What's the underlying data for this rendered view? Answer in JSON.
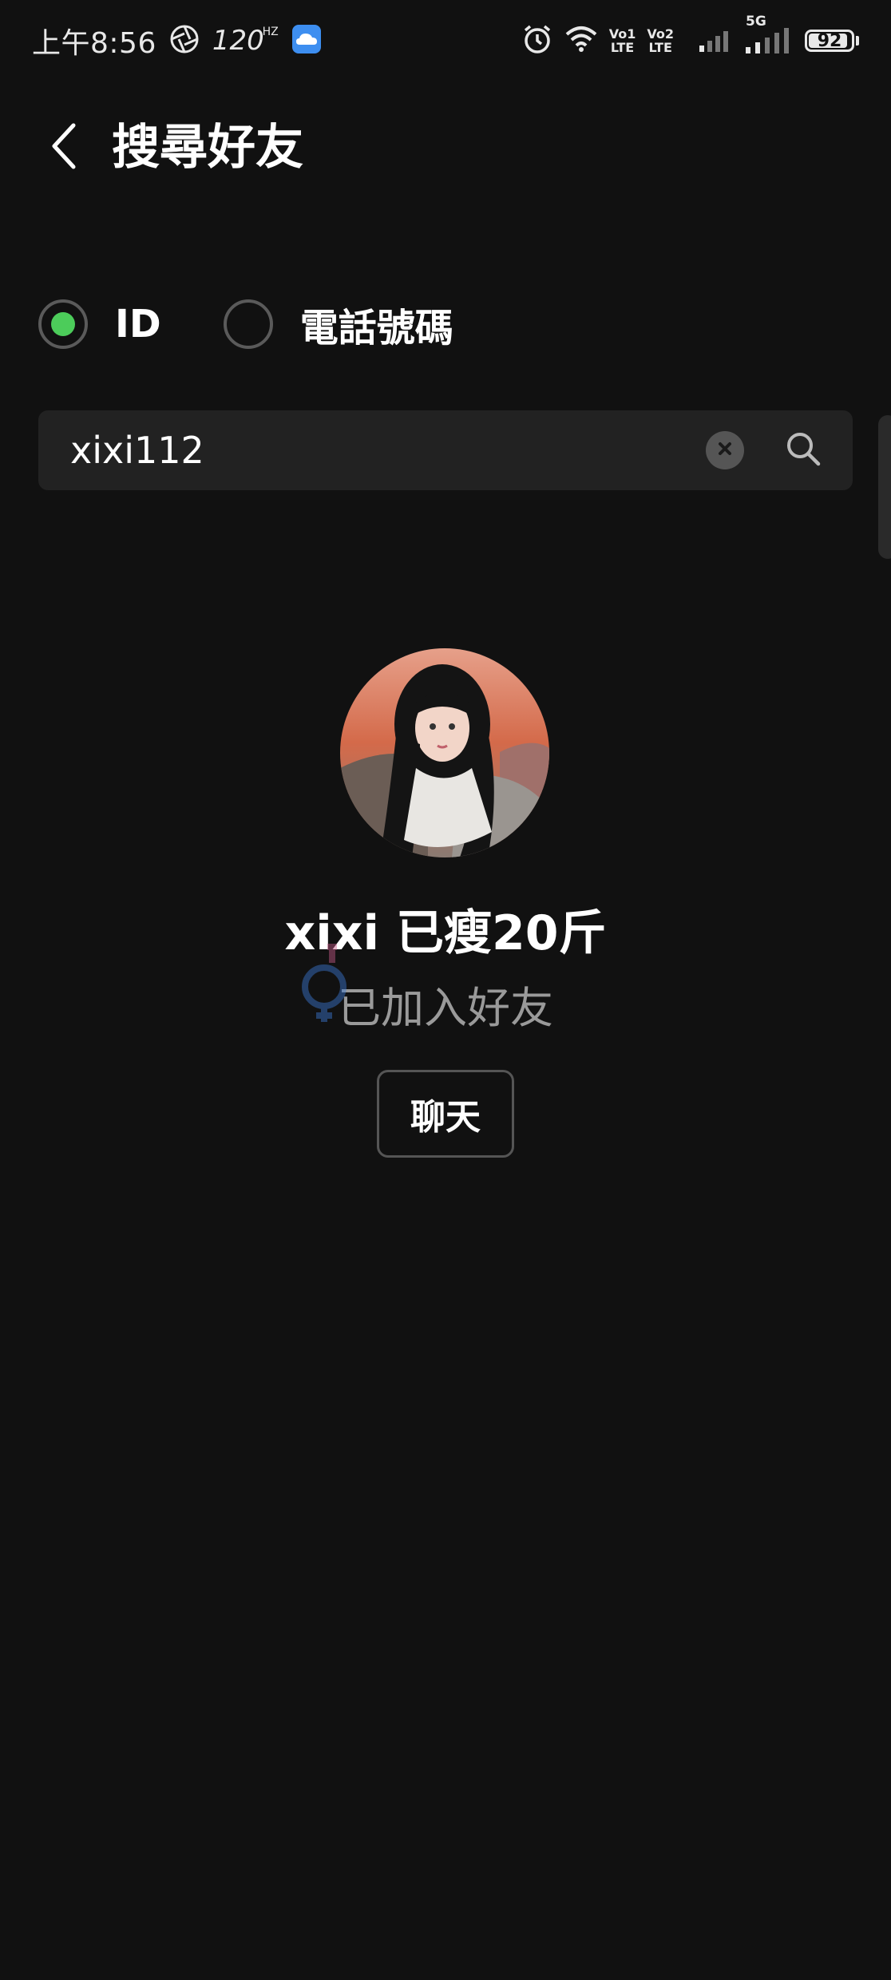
{
  "status_bar": {
    "time": "上午8:56",
    "refresh_rate": "120",
    "refresh_unit": "HZ",
    "volte_1": [
      "Vo1",
      "LTE"
    ],
    "volte_2": [
      "Vo2",
      "LTE"
    ],
    "network": "5G",
    "battery_level": "92"
  },
  "header": {
    "title": "搜尋好友"
  },
  "search_type": {
    "options": [
      {
        "label": "ID",
        "selected": true
      },
      {
        "label": "電話號碼",
        "selected": false
      }
    ]
  },
  "search": {
    "value": "xixi112"
  },
  "result": {
    "name": "xixi 已瘦20斤",
    "status": "已加入好友",
    "chat_label": "聊天"
  },
  "colors": {
    "background": "#111111",
    "accent": "#4ccc5a",
    "search_bg": "#222222",
    "muted_text": "#9a9a9a"
  },
  "icons": {
    "back": "chevron-left-icon",
    "clear": "clear-icon",
    "search": "search-icon"
  }
}
